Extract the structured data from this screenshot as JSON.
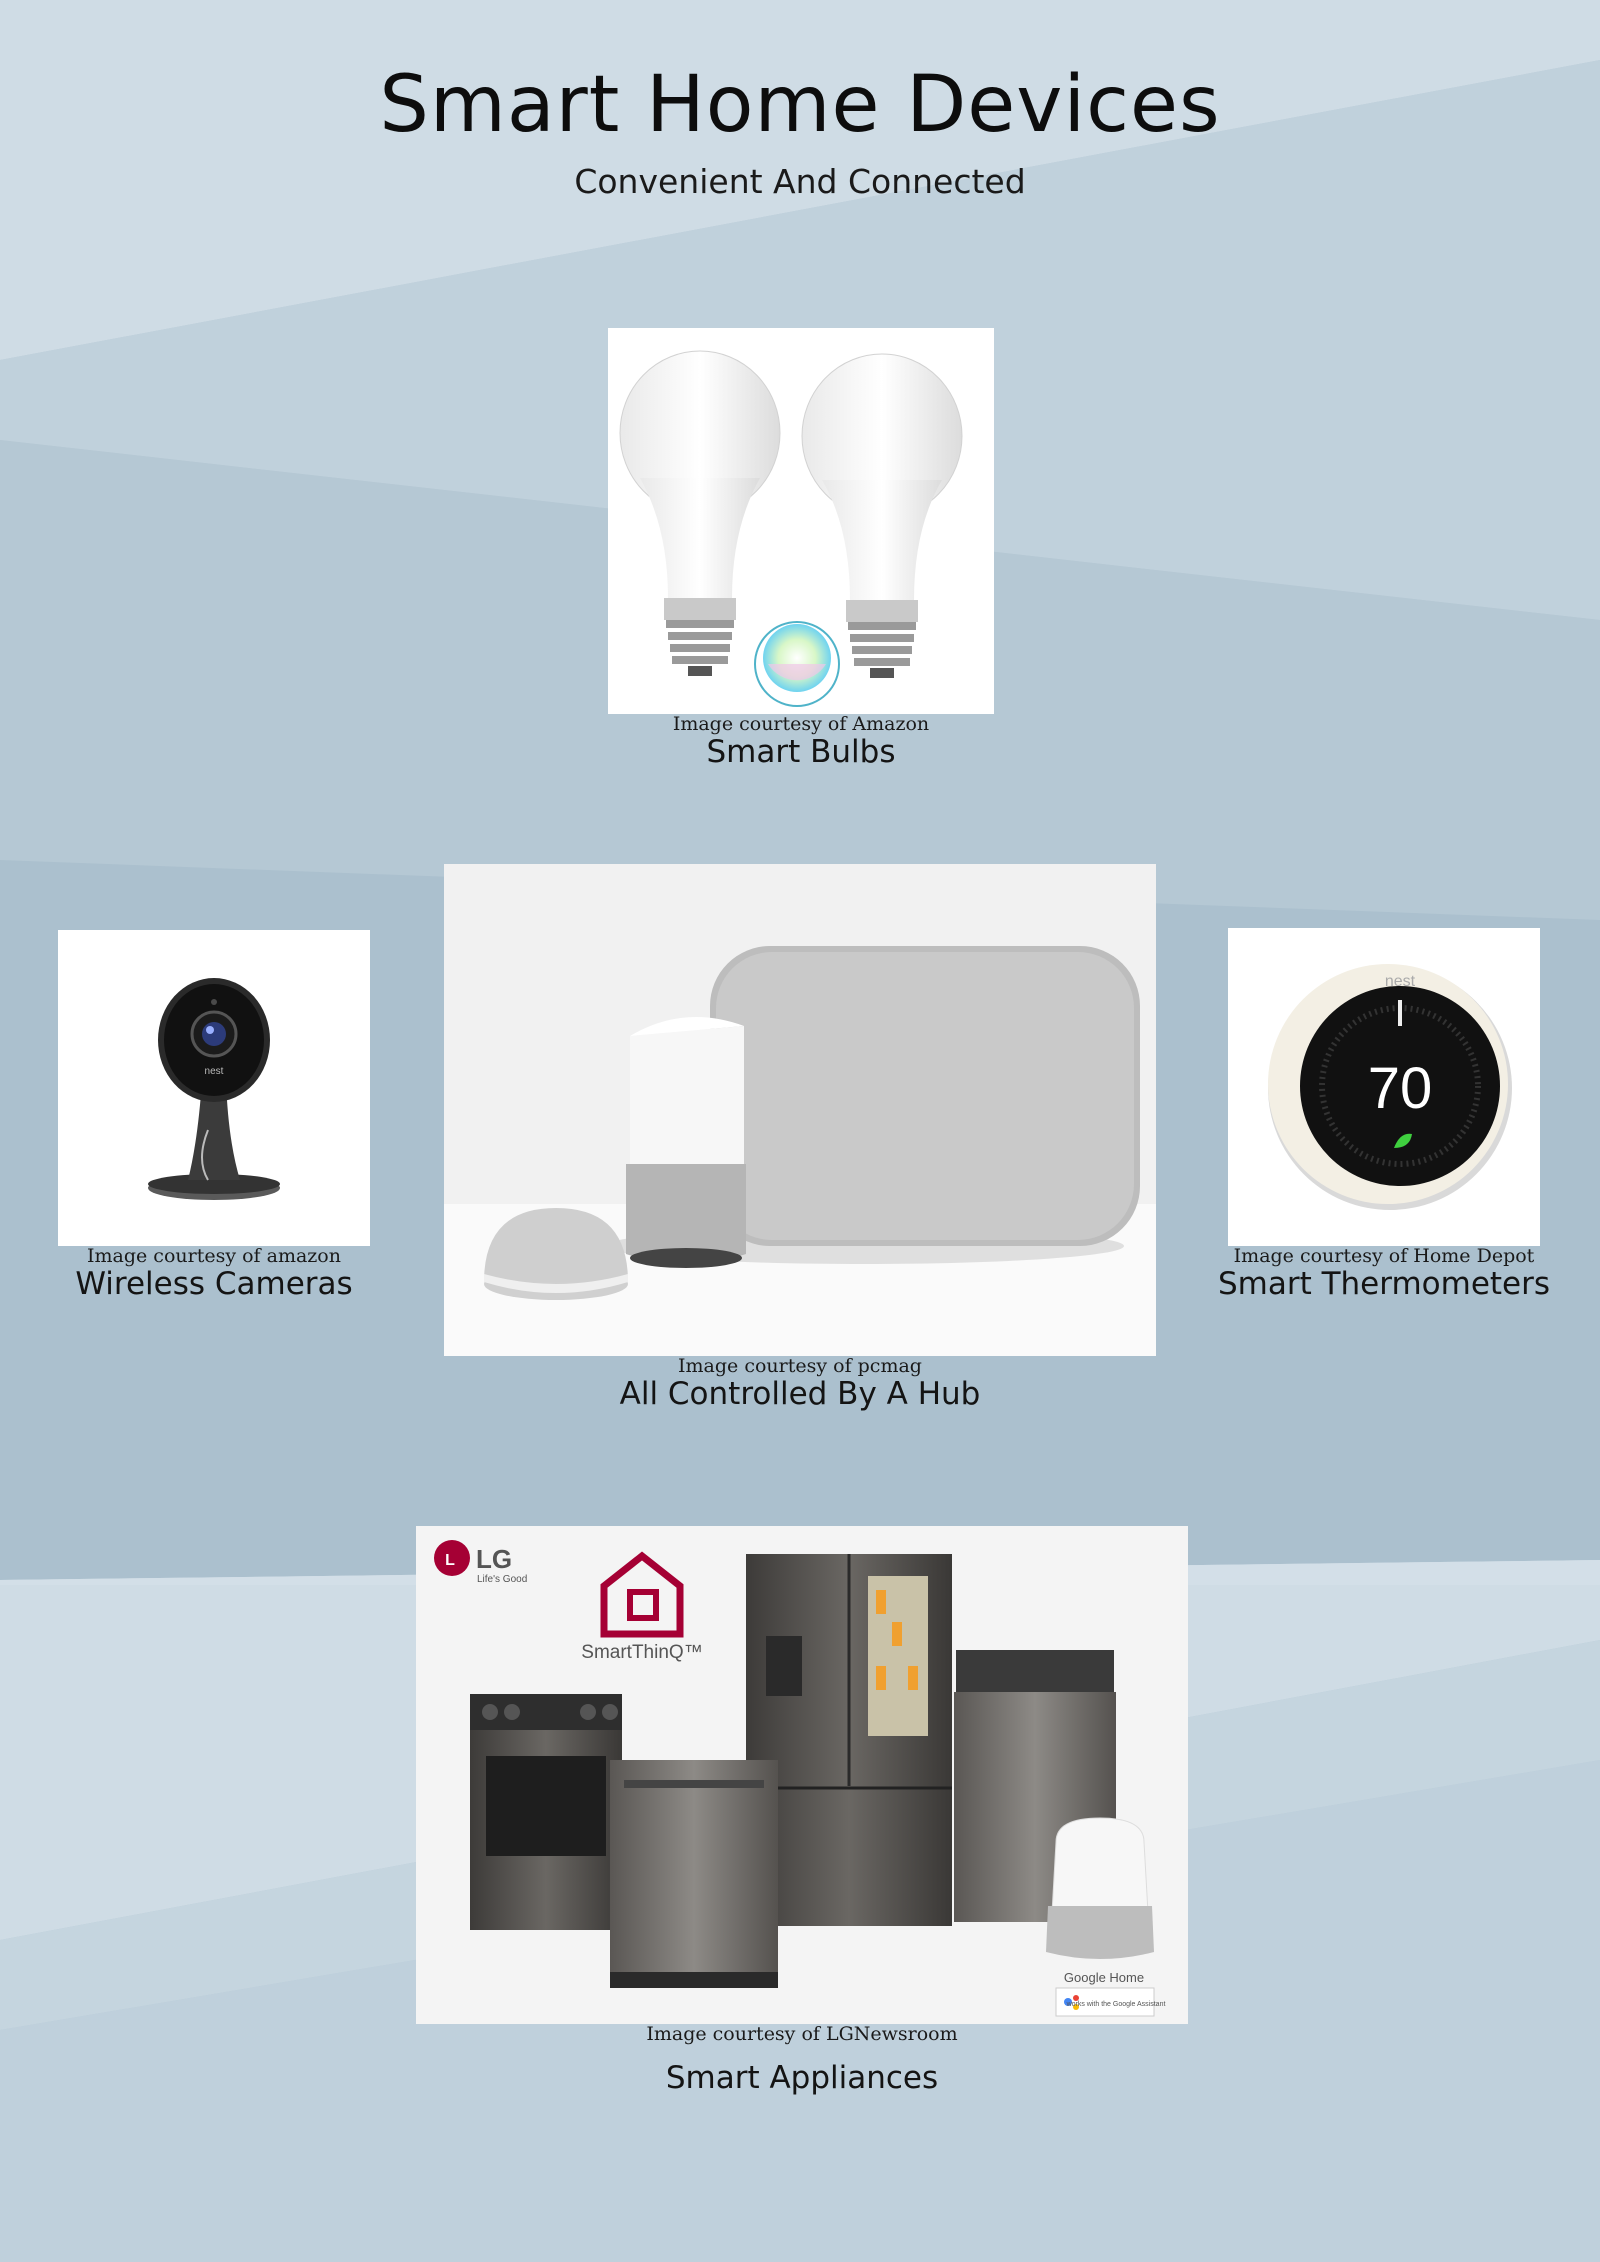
{
  "page": {
    "title": "Smart Home Devices",
    "subtitle": "Convenient And Connected"
  },
  "products": {
    "bulbs": {
      "credit": "Image courtesy of Amazon",
      "label": "Smart Bulbs"
    },
    "cameras": {
      "credit": "Image courtesy of amazon",
      "label": "Wireless Cameras"
    },
    "hub": {
      "credit": "Image courtesy of pcmag",
      "label": "All Controlled By A Hub"
    },
    "thermostats": {
      "credit": "Image courtesy of Home Depot",
      "label": "Smart Thermometers",
      "display_value": "70",
      "brand": "nest"
    },
    "appliances": {
      "credit": "Image courtesy of LGNewsroom",
      "label": "Smart Appliances",
      "brand_logo": "LG",
      "brand_tagline": "Life's Good",
      "platform_logo": "SmartThinQ™",
      "speaker_caption": "Google Home",
      "badge_text": "works with the Google Assistant"
    }
  },
  "colors": {
    "background": "#b4c7d3",
    "band_light": "#cfdce5",
    "band_dark": "#a7bccb",
    "lg_red": "#a50034"
  }
}
